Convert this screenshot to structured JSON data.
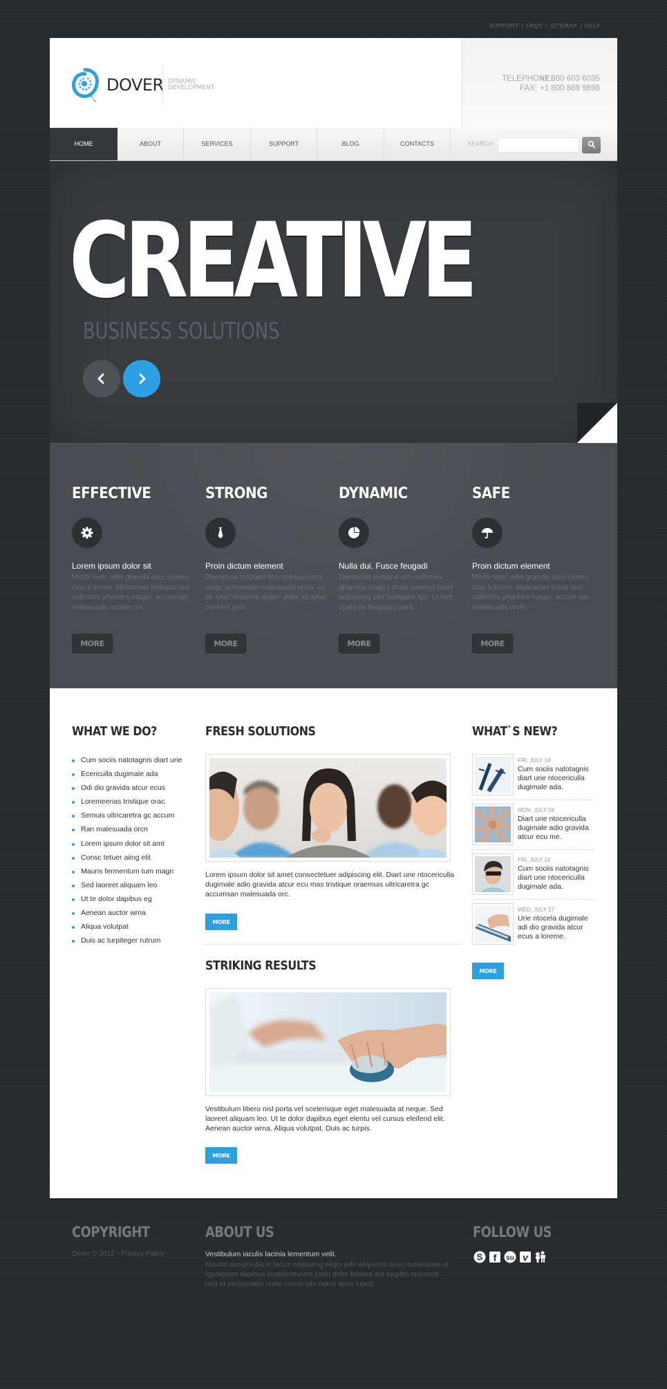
{
  "top_links": [
    "SUPPORT",
    "FAQS",
    "SITEMAP",
    "HELP"
  ],
  "top_links_separator": "|",
  "brand": {
    "name": "DOVER",
    "tagline_line1": "DYNAMIC",
    "tagline_line2": "DEVELOPMENT",
    "logo_color": "#2d9fe3"
  },
  "contact": {
    "telephone_label": "TELEPHONE:",
    "telephone": "+1 800 603 6035",
    "fax_label": "FAX:",
    "fax": "+1 800 889 9898"
  },
  "nav": {
    "items": [
      {
        "label": "HOME",
        "active": true
      },
      {
        "label": "ABOUT",
        "active": false
      },
      {
        "label": "SERVICES",
        "active": false
      },
      {
        "label": "SUPPORT",
        "active": false
      },
      {
        "label": "BLOG",
        "active": false
      },
      {
        "label": "CONTACTS",
        "active": false
      }
    ],
    "search_label": "SEARCH",
    "search_value": "",
    "search_icon": "magnifier-icon"
  },
  "hero": {
    "title": "CREATIVE",
    "subtitle": "BUSINESS SOLUTIONS",
    "prev_icon": "chevron-left-icon",
    "next_icon": "chevron-right-icon",
    "accent": "#2d9fe3"
  },
  "features": [
    {
      "title": "EFFECTIVE",
      "icon": "gear-icon",
      "heading": "Lorem ipsum dolor sit",
      "text": "Morbi nunc odio gravida atcu rsuseu ctus a lorem. Maecenas tristique orci sultricies pharetra magec accumsan malesuada orcinec sit.",
      "button": "MORE"
    },
    {
      "title": "STRONG",
      "icon": "tie-icon",
      "heading": "Proin dictum element",
      "text": "Daecenas tristique orci sultricie retra magc accumsan malesuada orcin. ec sit amet eroorem ipsum dolor sit amet consect gelit.",
      "button": "MORE"
    },
    {
      "title": "DYNAMIC",
      "icon": "pie-chart-icon",
      "heading": "Nulla dui. Fusce feugadi",
      "text": "Daecenas tristique orci sultricies pharetra magc t eroet consect etuer adipiscing elid laoiquam leo. Ut tvel curlla de feugadiq uara.",
      "button": "MORE"
    },
    {
      "title": "SAFE",
      "icon": "umbrella-icon",
      "heading": "Proin dictum element",
      "text": "Morbi nunc odio gravida atcu rsuseu ctus a lorem. Maecenas trisue orci sultricies pharetra magec accum san malesuada orcin.",
      "button": "MORE"
    }
  ],
  "what_we_do": {
    "title": "WHAT WE DO?",
    "items": [
      "Cum sociis natotagnis diart urie",
      "Ecericulla dugimale ada",
      "Odi dio gravida atcur ecus",
      "Loremeenas tristique orac",
      "Semuis ultricaretra gc accum",
      "Ran malesuada orcn",
      "Lorem ipsum dolor sit amt",
      "Consc tetuer aiing elit",
      "Mauris fermentum tum magn",
      "Sed laoreet aliquam leo",
      "Ut te dolor dapibus eg",
      "Aenean auctor wrna",
      "Aliqua volutpat",
      "Duis ac turpiteger rutrum"
    ]
  },
  "fresh_solutions": {
    "title": "FRESH SOLUTIONS",
    "image": "business-team-photo",
    "text": "Lorem ipsum dolor sit amet consectetuer adipiscing elit. Diart urie ntocericulla dugimale adio gravida atcur ecu mas tristique oraemuis ultricaretra gc accumsan malesuada orc.",
    "button": "MORE"
  },
  "striking_results": {
    "title": "STRIKING RESULTS",
    "image": "hand-on-mouse-photo",
    "text": "Vestibulum libero nisl porta vel scelerisque eget malesuada at neque. Sed laoreet aliquam leo. Ut te dolor dapibus eget elentu vel cursus eleifend elit. Aenean auctor wrna. Aliqua volutpat. Duis ac turpis.",
    "button": "MORE"
  },
  "whats_new": {
    "title": "WHAT`S NEW?",
    "items": [
      {
        "date": "FRI, JULY 18",
        "text": "Cum sociis natotagnis diart urie ntocericulla dugimale ada.",
        "thumb": "clock-photo"
      },
      {
        "date": "MON, JULY 04",
        "text": "Diart urie ntocericulla dugimale adio gravida atcur ecu me.",
        "thumb": "team-hands-photo"
      },
      {
        "date": "FRI, JULY 24",
        "text": "Cum sociis natotagnis diart urie ntocericulla dugimale ada.",
        "thumb": "man-sunglasses-photo"
      },
      {
        "date": "WED, JULY 17",
        "text": "Urie ntocela dugimale adi dio gravida atcur ecus a loreme.",
        "thumb": "keyboard-photo"
      }
    ],
    "button": "MORE"
  },
  "footer": {
    "copyright_title": "COPYRIGHT",
    "copyright_text": "Dover © 2012 •",
    "privacy_link": "Privacy Policy",
    "about_title": "ABOUT US",
    "about_lead": "Vestibulum iaculis lacinia lementum velit.",
    "about_text": "Mauris accuml dia in lacus edipiscng aliqln pde aliquetsit amet euisnuctor ut liguliquam dapibus tinciduntturent justo dolor loboed ant sagittis euismod ped ut perspiciatis unde omnis iste natus error luptat.",
    "follow_title": "FOLLOW US",
    "social": [
      "skype-icon",
      "facebook-icon",
      "stumbleupon-icon",
      "vimeo-icon",
      "myspace-icon"
    ]
  }
}
